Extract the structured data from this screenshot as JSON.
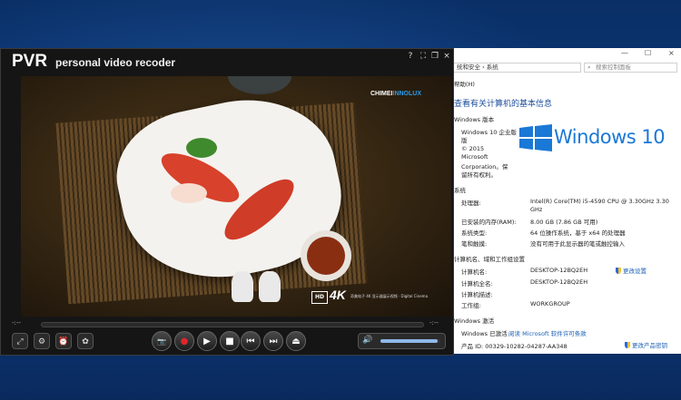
{
  "pvr": {
    "title": "PVR",
    "subtitle": "personal video recoder",
    "window_buttons": {
      "help": "?",
      "fullscreen": "⛶",
      "restore": "❐",
      "close": "×"
    },
    "time_current": "-:--",
    "time_total": "-:--",
    "volume_fraction": 0.95,
    "video_overlay": {
      "brand_prefix": "CHIMEI",
      "brand_suffix": "INNOLUX",
      "hd_badge": "HD",
      "uhd_badge": "4K",
      "caption": "奇美电子 4K 显示器展示视频 · Digital Cinema"
    },
    "controls": {
      "capture": "⤢",
      "settings": "⚙",
      "schedule": "⏰",
      "effects": "✿",
      "snapshot": "📷",
      "record": "●",
      "play": "▶",
      "stop": "■",
      "prev": "⏮",
      "next": "⏭",
      "eject": "⏏",
      "volume": "🔊"
    }
  },
  "system": {
    "controls": {
      "minimize": "—",
      "maximize": "☐",
      "close": "×"
    },
    "address": "统和安全 › 系统",
    "search_placeholder": "搜索控制面板",
    "help_menu": "帮助(H)",
    "heading": "查看有关计算机的基本信息",
    "windows_edition": {
      "section": "Windows 版本",
      "edition": "Windows 10 企业版",
      "edition_line2": "版",
      "copyright": "© 2015",
      "company": "Microsoft",
      "company2": "Corporation。保",
      "rights": "留所有权利。",
      "logo_text": "Windows 10"
    },
    "system_section": {
      "section": "系统",
      "rows": [
        {
          "label": "处理器:",
          "value": "Intel(R) Core(TM) i5-4590 CPU @ 3.30GHz   3.30",
          "value2": "GHz"
        },
        {
          "label": "已安装的内存(RAM):",
          "value": "8.00 GB (7.86 GB 可用)"
        },
        {
          "label": "系统类型:",
          "value": "64 位操作系统，基于 x64 的处理器"
        },
        {
          "label": "笔和触摸:",
          "value": "没有可用于此显示器的笔或触控输入"
        }
      ]
    },
    "computer_section": {
      "section": "计算机名、域和工作组设置",
      "rows": [
        {
          "label": "计算机名:",
          "value": "DESKTOP-12BQ2EH"
        },
        {
          "label": "计算机全名:",
          "value": "DESKTOP-12BQ2EH"
        },
        {
          "label": "计算机描述:",
          "value": ""
        },
        {
          "label": "工作组:",
          "value": "WORKGROUP"
        }
      ],
      "change_settings": "更改设置"
    },
    "activation": {
      "section": "Windows 激活",
      "status": "Windows 已激活",
      "license_link": "阅读 Microsoft 软件许可条款",
      "product_id": "产品 ID: 00329-10282-04287-AA348",
      "change_key": "更改产品密钥"
    }
  }
}
